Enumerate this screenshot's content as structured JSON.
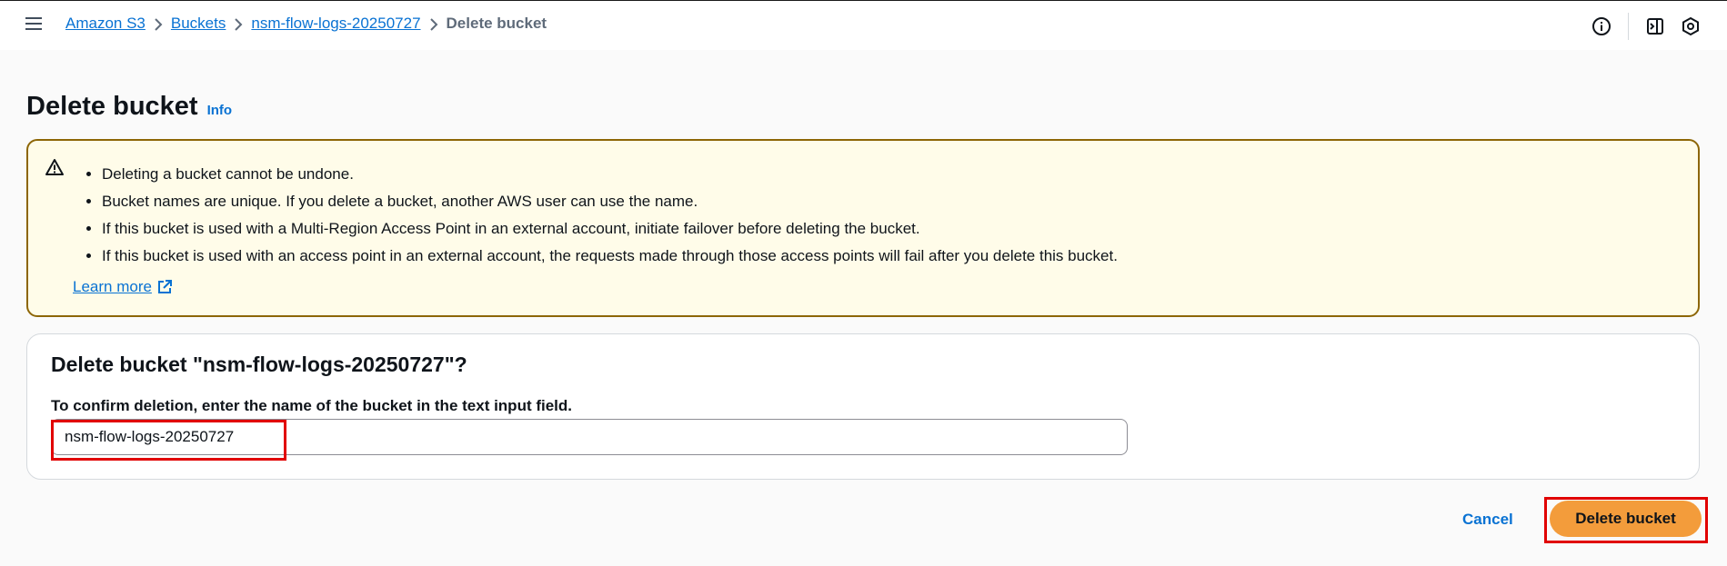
{
  "breadcrumb": {
    "items": [
      "Amazon S3",
      "Buckets",
      "nsm-flow-logs-20250727"
    ],
    "current": "Delete bucket"
  },
  "page": {
    "title": "Delete bucket",
    "info_label": "Info"
  },
  "warning": {
    "items": [
      "Deleting a bucket cannot be undone.",
      "Bucket names are unique. If you delete a bucket, another AWS user can use the name.",
      "If this bucket is used with a Multi-Region Access Point in an external account, initiate failover before deleting the bucket.",
      "If this bucket is used with an access point in an external account, the requests made through those access points will fail after you delete this bucket."
    ],
    "learn_more": "Learn more"
  },
  "confirm": {
    "heading": "Delete bucket \"nsm-flow-logs-20250727\"?",
    "label": "To confirm deletion, enter the name of the bucket in the text input field.",
    "value": "nsm-flow-logs-20250727"
  },
  "actions": {
    "cancel": "Cancel",
    "delete": "Delete bucket"
  },
  "colors": {
    "link": "#0972d3",
    "warning_bg": "#fffce9",
    "warning_border": "#8d6605",
    "primary_button": "#f39c3b",
    "highlight": "#e10000"
  }
}
